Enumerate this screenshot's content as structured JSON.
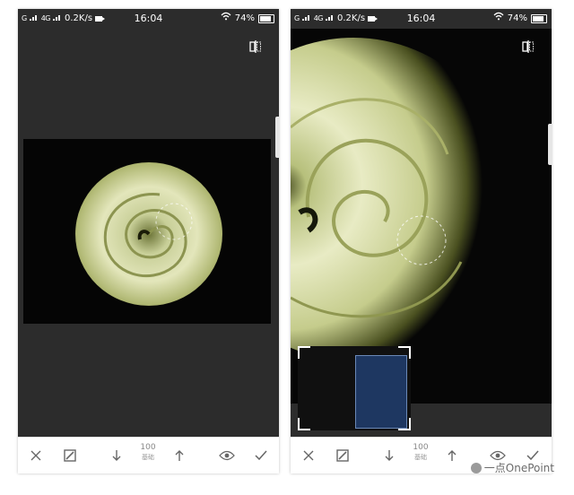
{
  "status_bar": {
    "network_left": "G",
    "network_mid": "4G",
    "speed": "0.2K/s",
    "time": "16:04",
    "battery": "74%"
  },
  "toolbar": {
    "value": "100",
    "value_label": "基础"
  },
  "icons": {
    "close": "close-icon",
    "brush": "brush-icon",
    "down": "arrow-down-icon",
    "up": "arrow-up-icon",
    "eye": "eye-icon",
    "confirm": "check-icon",
    "compare": "compare-icon"
  },
  "watermark": {
    "text": "一点OnePoint"
  },
  "colors": {
    "background": "#2c2c2c",
    "rose_highlight": "#e8ebc4",
    "rose_core": "#a8b476",
    "selection_blue": "#1f3a66"
  }
}
